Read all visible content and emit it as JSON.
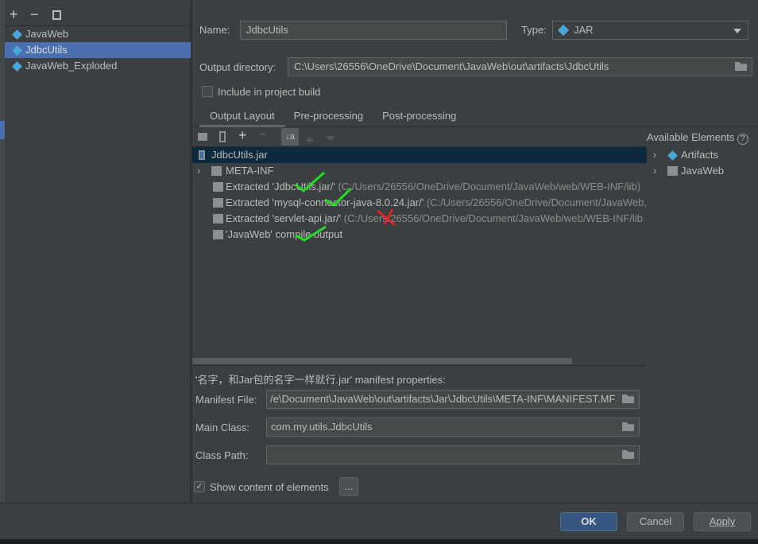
{
  "left_toolbar": {
    "add": "+",
    "remove": "−",
    "copy": "copy"
  },
  "artifacts": [
    {
      "label": "JavaWeb",
      "selected": false
    },
    {
      "label": "JdbcUtils",
      "selected": true
    },
    {
      "label": "JavaWeb_Exploded",
      "selected": false
    }
  ],
  "form": {
    "name_label": "Name:",
    "name_value": "JdbcUtils",
    "type_label": "Type:",
    "type_value": "JAR",
    "output_dir_label": "Output directory:",
    "output_dir_value": "C:\\Users\\26556\\OneDrive\\Document\\JavaWeb\\out\\artifacts\\JdbcUtils",
    "include_label": "Include in project build",
    "include_checked": false
  },
  "tabs": [
    {
      "label": "Output Layout",
      "active": true
    },
    {
      "label": "Pre-processing"
    },
    {
      "label": "Post-processing"
    }
  ],
  "tree": [
    {
      "label": "JdbcUtils.jar",
      "path": "",
      "icon": "jar-icon"
    },
    {
      "label": "META-INF",
      "path": "",
      "icon": "folder-icon"
    },
    {
      "label": "Extracted 'JdbcUtils.jar/'",
      "path": "(C:/Users/26556/OneDrive/Document/JavaWeb/web/WEB-INF/lib)",
      "icon": "extracted-icon"
    },
    {
      "label": "Extracted 'mysql-connector-java-8.0.24.jar/'",
      "path": "(C:/Users/26556/OneDrive/Document/JavaWeb,",
      "icon": "extracted-icon"
    },
    {
      "label": "Extracted 'servlet-api.jar/'",
      "path": "(C:/Users/26556/OneDrive/Document/JavaWeb/web/WEB-INF/lib",
      "icon": "extracted-icon"
    },
    {
      "label": "'JavaWeb' compile output",
      "path": "",
      "icon": "module-output-icon"
    }
  ],
  "available": {
    "title": "Available Elements",
    "items": [
      "Artifacts",
      "JavaWeb"
    ]
  },
  "manifest": {
    "title": "'名字，和Jar包的名字一样就行.jar' manifest properties:",
    "file_label": "Manifest File:",
    "file_value": "/e\\Document\\JavaWeb\\out\\artifacts\\Jar\\JdbcUtils\\META-INF\\MANIFEST.MF",
    "main_label": "Main Class:",
    "main_value": "com.my.utils.JdbcUtils",
    "cp_label": "Class Path:",
    "cp_value": ""
  },
  "show_content": {
    "label": "Show content of elements",
    "checked": true,
    "more": "..."
  },
  "buttons": {
    "ok": "OK",
    "cancel": "Cancel",
    "apply": "Apply"
  },
  "colors": {
    "selection": "#4b6eaf",
    "tree_selection": "#0d293e",
    "ok": "#365880",
    "check_mark": "#22dd22",
    "cross_mark": "#ee2222"
  }
}
